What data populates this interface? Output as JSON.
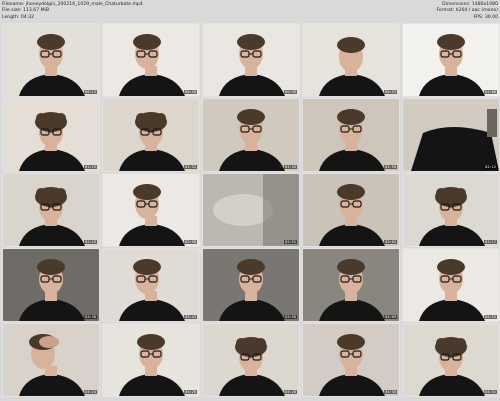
{
  "header": {
    "filename": "Filename: jhoneydolgin_200216_1029_male_Chaturbate.mp4",
    "filesize": "File size: 113.67 MiB",
    "length": "Length: 04:32",
    "dimensions": "Dimensions: 1480x1080",
    "format": "Format: h264 / aac (mono)",
    "fps": "FPS: 30.00"
  },
  "thumbnails": [
    {
      "time": "00:13",
      "bg": "#e3e0da",
      "variant": "glasses-front"
    },
    {
      "time": "00:26",
      "bg": "#ece9e4",
      "variant": "glasses-tilt"
    },
    {
      "time": "00:39",
      "bg": "#eae7e2",
      "variant": "glasses-front"
    },
    {
      "time": "00:53",
      "bg": "#e6e3dd",
      "variant": "head-down"
    },
    {
      "time": "01:06",
      "bg": "#f2f1ee",
      "variant": "glasses-front"
    },
    {
      "time": "01:19",
      "bg": "#e4ded6",
      "variant": "curly-down"
    },
    {
      "time": "01:32",
      "bg": "#dcd6cd",
      "variant": "curly-down"
    },
    {
      "time": "01:45",
      "bg": "#cfc9bf",
      "variant": "glasses-front"
    },
    {
      "time": "01:58",
      "bg": "#cec6bb",
      "variant": "glasses-front"
    },
    {
      "time": "02:12",
      "bg": "#d2cbc2",
      "variant": "shoulder"
    },
    {
      "time": "02:25",
      "bg": "#d9d4cc",
      "variant": "curly-down"
    },
    {
      "time": "02:38",
      "bg": "#ece9e4",
      "variant": "glasses-tilt"
    },
    {
      "time": "02:51",
      "bg": "#bdb8b2",
      "variant": "blur"
    },
    {
      "time": "03:04",
      "bg": "#c9c3ba",
      "variant": "glasses-front"
    },
    {
      "time": "03:17",
      "bg": "#dcd8d2",
      "variant": "curly-down"
    },
    {
      "time": "03:30",
      "bg": "#6f6b66",
      "variant": "glasses-front"
    },
    {
      "time": "03:43",
      "bg": "#e0dbd4",
      "variant": "glasses-tilt"
    },
    {
      "time": "03:56",
      "bg": "#7a7671",
      "variant": "glasses-front"
    },
    {
      "time": "04:09",
      "bg": "#8a857f",
      "variant": "glasses-front"
    },
    {
      "time": "04:22",
      "bg": "#ece9e4",
      "variant": "glasses-front"
    },
    {
      "time": "04:24",
      "bg": "#d8d2ca",
      "variant": "hand-head"
    },
    {
      "time": "04:26",
      "bg": "#e7e3dd",
      "variant": "glasses-front"
    },
    {
      "time": "04:28",
      "bg": "#dcd7cf",
      "variant": "curly-down"
    },
    {
      "time": "04:30",
      "bg": "#d2ccc4",
      "variant": "glasses-front"
    },
    {
      "time": "04:31",
      "bg": "#ddd8d0",
      "variant": "curly-down"
    }
  ]
}
